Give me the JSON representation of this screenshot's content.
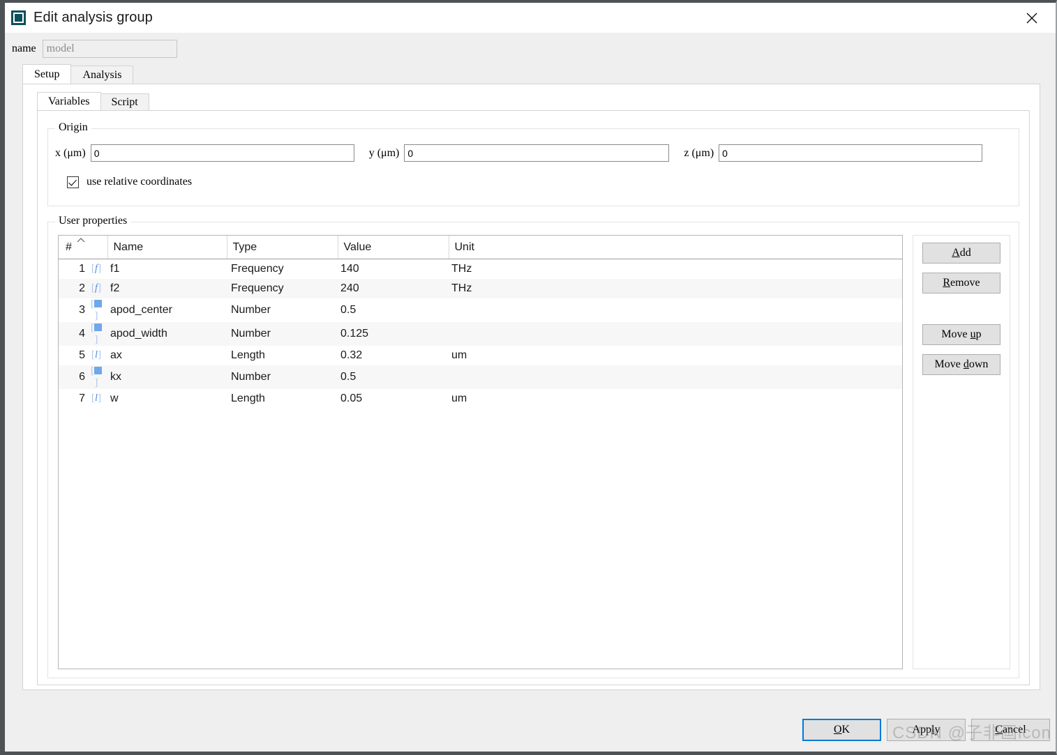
{
  "window": {
    "title": "Edit analysis group",
    "icon": "app-square-icon",
    "close_icon": "close-icon"
  },
  "name_field": {
    "label": "name",
    "value": "model"
  },
  "tabs": {
    "outer": [
      {
        "label": "Setup",
        "active": true
      },
      {
        "label": "Analysis",
        "active": false
      }
    ],
    "inner": [
      {
        "label": "Variables",
        "active": true
      },
      {
        "label": "Script",
        "active": false
      }
    ]
  },
  "origin": {
    "title": "Origin",
    "fields": [
      {
        "label": "x (μm)",
        "value": "0"
      },
      {
        "label": "y (μm)",
        "value": "0"
      },
      {
        "label": "z (μm)",
        "value": "0"
      }
    ],
    "checkbox": {
      "label": "use relative coordinates",
      "checked": true
    }
  },
  "user_properties": {
    "title": "User properties",
    "columns": [
      "#",
      "Name",
      "Type",
      "Value",
      "Unit"
    ],
    "sort_column": "#",
    "sort_direction": "ascending",
    "rows": [
      {
        "num": "1",
        "icon": "function-variable-icon",
        "name": "f1",
        "type": "Frequency",
        "value": "140",
        "unit": "THz"
      },
      {
        "num": "2",
        "icon": "function-variable-icon",
        "name": "f2",
        "type": "Frequency",
        "value": "240",
        "unit": "THz"
      },
      {
        "num": "3",
        "icon": "number-variable-icon",
        "name": "apod_center",
        "type": "Number",
        "value": "0.5",
        "unit": ""
      },
      {
        "num": "4",
        "icon": "number-variable-icon",
        "name": "apod_width",
        "type": "Number",
        "value": "0.125",
        "unit": ""
      },
      {
        "num": "5",
        "icon": "length-variable-icon",
        "name": "ax",
        "type": "Length",
        "value": "0.32",
        "unit": "um"
      },
      {
        "num": "6",
        "icon": "number-variable-icon",
        "name": "kx",
        "type": "Number",
        "value": "0.5",
        "unit": ""
      },
      {
        "num": "7",
        "icon": "length-variable-icon",
        "name": "w",
        "type": "Length",
        "value": "0.05",
        "unit": "um"
      }
    ],
    "side_buttons": [
      {
        "label": "Add",
        "mnemonic": "A"
      },
      {
        "label": "Remove",
        "mnemonic": "R"
      },
      {
        "label": "Move up",
        "mnemonic": "u"
      },
      {
        "label": "Move down",
        "mnemonic": "d"
      }
    ]
  },
  "dialog_buttons": [
    {
      "label": "OK",
      "mnemonic": "O",
      "primary": true
    },
    {
      "label": "Apply",
      "mnemonic": "l",
      "primary": false
    },
    {
      "label": "Cancel",
      "mnemonic": "C",
      "primary": false
    }
  ],
  "watermark": "CSDN @子非画icon",
  "colors": {
    "title_icon": "#0d4f5c",
    "focus_border": "#0078d7",
    "dialog_bg": "#efefef",
    "panel_bg": "#ffffff",
    "row_alt": "#f7f7f7",
    "variable_icon_blue": "#6fa8e8"
  }
}
